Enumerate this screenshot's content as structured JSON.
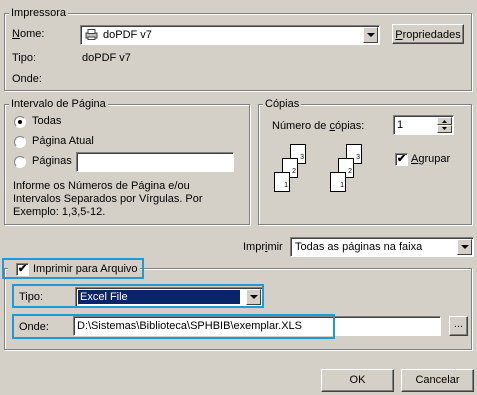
{
  "printer": {
    "legend": "Impressora",
    "name_label": "Nome:",
    "name_value": "doPDF v7",
    "properties_button": "Propriedades",
    "type_label": "Tipo:",
    "type_value": "doPDF v7",
    "where_label": "Onde:"
  },
  "range": {
    "legend": "Intervalo de Página",
    "all": "Todas",
    "current": "Página Atual",
    "pages": "Páginas",
    "help": [
      "Informe os Números de Página e/ou",
      "Intervalos Separados por Vírgulas. Por",
      "Exemplo: 1,3,5-12."
    ]
  },
  "copies": {
    "legend": "Cópias",
    "count_label": "Número de cópias:",
    "count_value": "1",
    "collate_label": "Agrupar",
    "page_numbers": [
      "1",
      "2",
      "3"
    ]
  },
  "print_what": {
    "label": "Imprimir",
    "value": "Todas as páginas na faixa"
  },
  "file": {
    "legend": "Imprimir para Arquivo",
    "type_label": "Tipo:",
    "type_value": "Excel File",
    "where_label": "Onde:",
    "where_value": "D:\\Sistemas\\Biblioteca\\SPHBIB\\exemplar.XLS",
    "browse": "..."
  },
  "buttons": {
    "ok": "OK",
    "cancel": "Cancelar"
  },
  "colors": {
    "highlight": "#1e9ad6",
    "selection": "#0a246a"
  }
}
